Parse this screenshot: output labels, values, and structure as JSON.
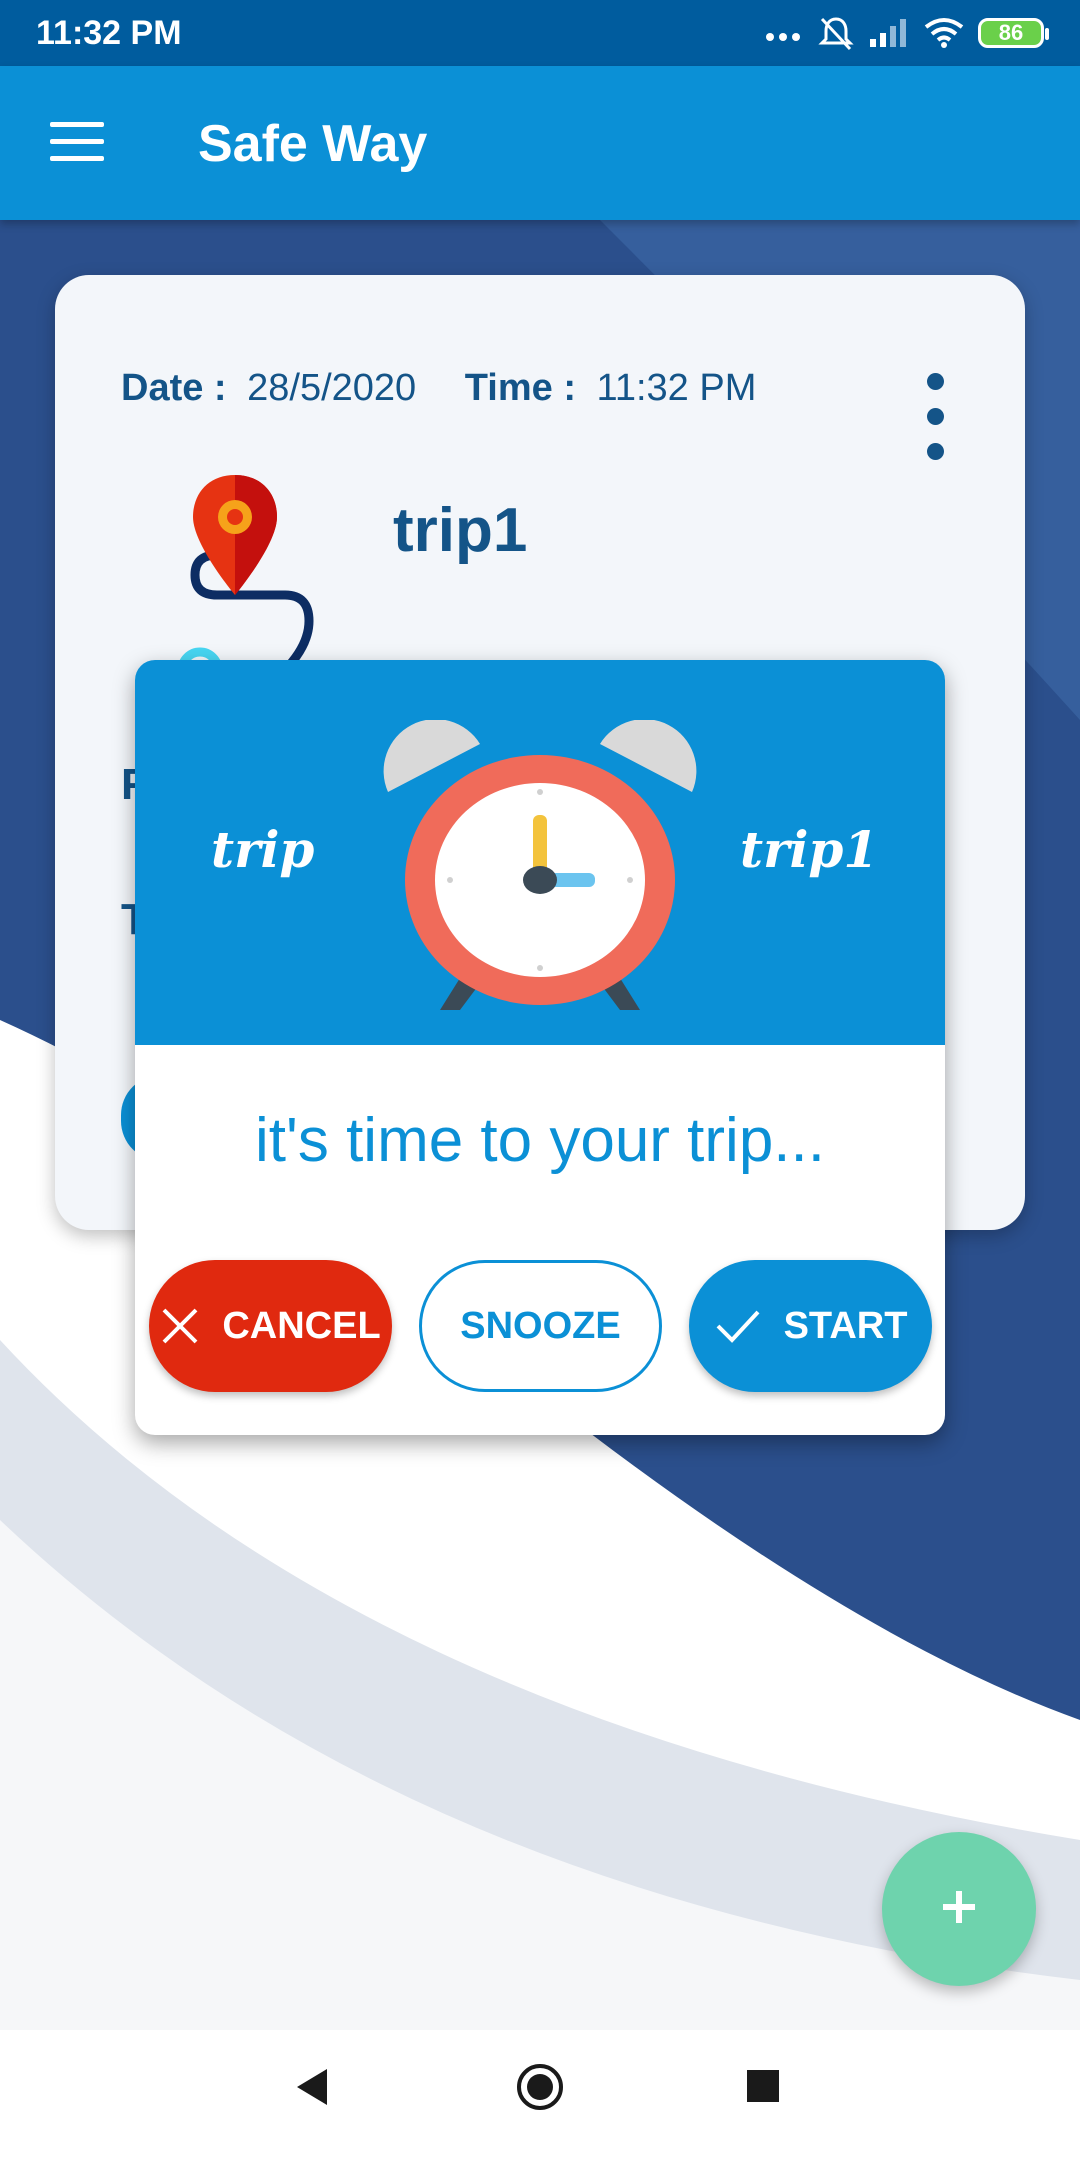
{
  "status_bar": {
    "time": "11:32 PM",
    "battery": "86",
    "icons": [
      "more-dots-icon",
      "bell-off-icon",
      "signal-icon",
      "wifi-icon",
      "battery-icon"
    ]
  },
  "app_bar": {
    "title": "Safe Way",
    "menu_icon": "hamburger-menu-icon"
  },
  "trip_card": {
    "date_label": "Date :",
    "date_value": "28/5/2020",
    "time_label": "Time :",
    "time_value": "11:32 PM",
    "trip_name": "trip1",
    "partial_letters": [
      "F",
      "T"
    ],
    "icons": [
      "route-pin-icon",
      "more-vertical-icon"
    ]
  },
  "dialog": {
    "header_left": "trip",
    "header_right": "trip1",
    "message": "it's time to your trip...",
    "buttons": {
      "cancel": "CANCEL",
      "snooze": "SNOOZE",
      "start": "START"
    },
    "icons": [
      "alarm-clock-icon",
      "close-icon",
      "check-icon"
    ]
  },
  "fab": {
    "icon": "plus-icon"
  },
  "nav_bar": {
    "icons": [
      "back-icon",
      "home-icon",
      "recents-icon"
    ]
  },
  "colors": {
    "primary": "#0b90d6",
    "status_bar": "#005c9e",
    "text_dark": "#145488",
    "cancel": "#e0290f",
    "fab": "#6ed3ad",
    "background_dark": "#2a4f8c"
  }
}
